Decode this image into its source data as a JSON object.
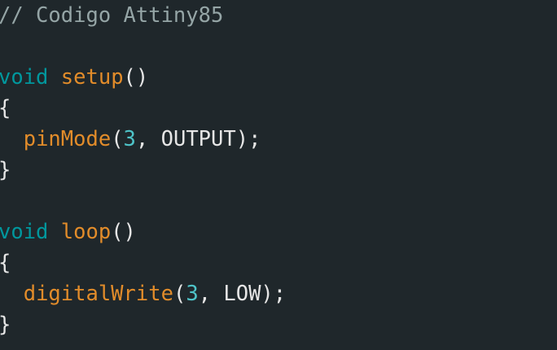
{
  "editor": {
    "background": "#1f272b",
    "colors": {
      "comment": "#95a5a6",
      "keyword": "#00979d",
      "function": "#e28c2a",
      "number": "#4ec3c8",
      "text": "#e6e6e6"
    },
    "lines": [
      [
        {
          "t": "// Codigo Attiny85",
          "c": "comment"
        }
      ],
      [],
      [
        {
          "t": "void",
          "c": "keyword"
        },
        {
          "t": " ",
          "c": "plain"
        },
        {
          "t": "setup",
          "c": "func"
        },
        {
          "t": "()",
          "c": "plain"
        }
      ],
      [
        {
          "t": "{",
          "c": "plain"
        }
      ],
      [
        {
          "t": "  ",
          "c": "plain"
        },
        {
          "t": "pinMode",
          "c": "func"
        },
        {
          "t": "(",
          "c": "plain"
        },
        {
          "t": "3",
          "c": "number"
        },
        {
          "t": ", OUTPUT);",
          "c": "plain"
        }
      ],
      [
        {
          "t": "}",
          "c": "plain"
        }
      ],
      [],
      [
        {
          "t": "void",
          "c": "keyword"
        },
        {
          "t": " ",
          "c": "plain"
        },
        {
          "t": "loop",
          "c": "func"
        },
        {
          "t": "()",
          "c": "plain"
        }
      ],
      [
        {
          "t": "{",
          "c": "plain"
        }
      ],
      [
        {
          "t": "  ",
          "c": "plain"
        },
        {
          "t": "digitalWrite",
          "c": "func"
        },
        {
          "t": "(",
          "c": "plain"
        },
        {
          "t": "3",
          "c": "number"
        },
        {
          "t": ", LOW);",
          "c": "plain"
        }
      ],
      [
        {
          "t": "}",
          "c": "plain"
        }
      ]
    ]
  }
}
